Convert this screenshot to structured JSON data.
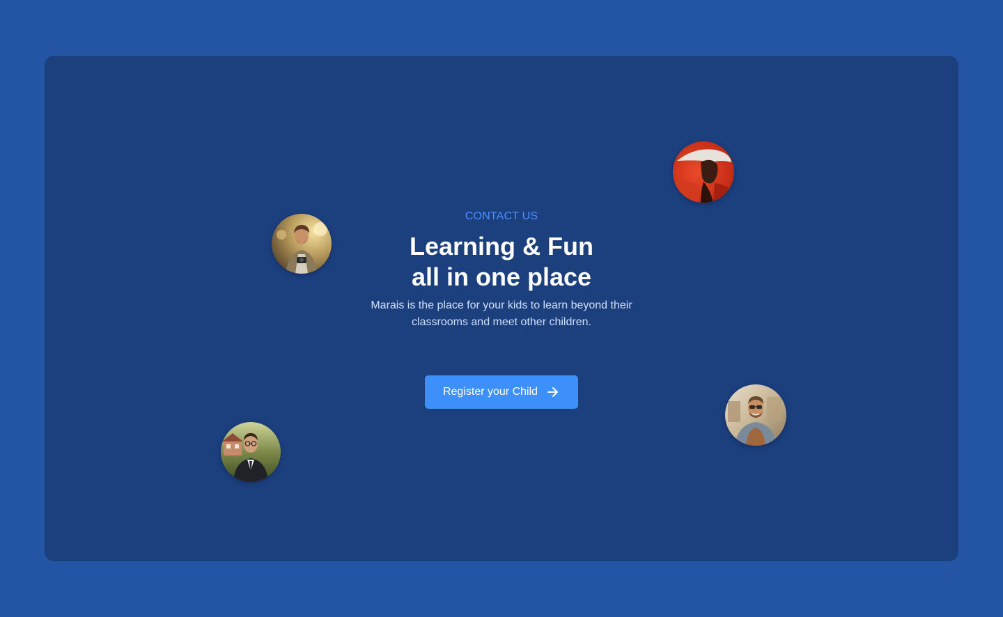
{
  "hero": {
    "eyebrow": "CONTACT US",
    "headline_line1": "Learning & Fun",
    "headline_line2": "all in one place",
    "description": "Marais is the place for your kids to learn beyond their classrooms and meet other children.",
    "cta_label": "Register your Child",
    "cta_icon": "arrow-right-icon"
  },
  "avatars": [
    {
      "name": "avatar-photographer",
      "alt": "man with camera"
    },
    {
      "name": "avatar-red-hat",
      "alt": "person in red hat"
    },
    {
      "name": "avatar-suit",
      "alt": "man in suit with glasses"
    },
    {
      "name": "avatar-sunglasses",
      "alt": "smiling man with sunglasses"
    }
  ],
  "colors": {
    "page_background": "#2355a4",
    "card_background": "#1c3f7e",
    "accent": "#3d8ffa",
    "eyebrow": "#4a90ff",
    "headline": "#ffffff",
    "description": "#cfe0ff"
  }
}
